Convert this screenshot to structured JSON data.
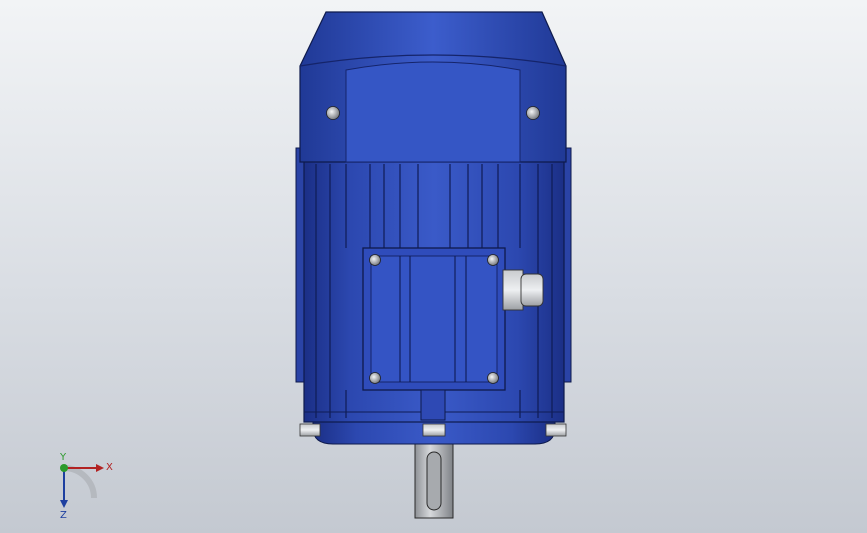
{
  "triad": {
    "x_label": "X",
    "y_label": "Y",
    "z_label": "Z"
  }
}
